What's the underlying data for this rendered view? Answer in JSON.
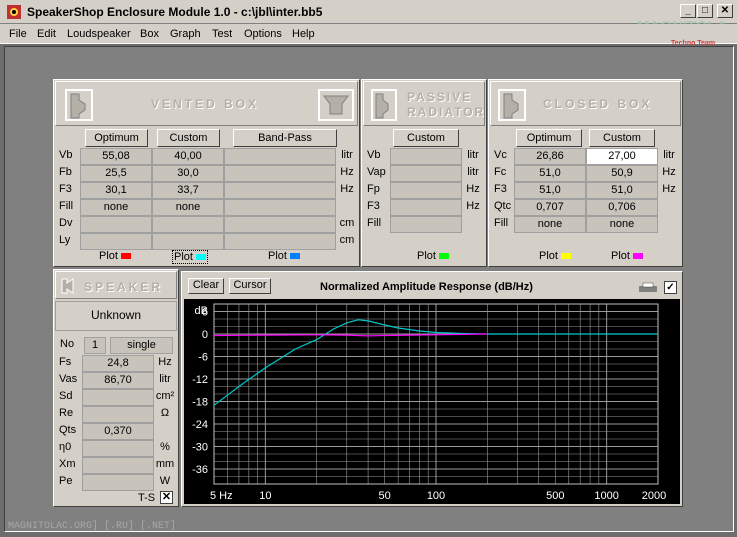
{
  "window": {
    "title": "SpeakerShop Enclosure Module 1.0 - c:\\jbl\\inter.bb5",
    "min": "_",
    "max": "□",
    "close": "✕"
  },
  "watermark_top": "MAGNITOLA",
  "watermark_sub": "Techno Team",
  "menu": [
    "File",
    "Edit",
    "Loudspeaker",
    "Box",
    "Graph",
    "Test",
    "Options",
    "Help"
  ],
  "vented": {
    "title": "VENTED BOX",
    "buttons": [
      "Optimum",
      "Custom",
      "Band-Pass"
    ],
    "labels": [
      "Vb",
      "Fb",
      "F3",
      "Fill",
      "Dv",
      "Ly"
    ],
    "units": [
      "litr",
      "Hz",
      "Hz",
      "",
      "cm",
      "cm"
    ],
    "optimum": [
      "55,08",
      "25,5",
      "30,1",
      "none",
      "",
      ""
    ],
    "custom": [
      "40,00",
      "30,0",
      "33,7",
      "none",
      "",
      ""
    ],
    "plot": "Plot",
    "colors": [
      "#ff0000",
      "#00ffff",
      "#0080ff"
    ]
  },
  "passive": {
    "title1": "PASSIVE",
    "title2": "RADIATOR",
    "button": "Custom",
    "labels": [
      "Vb",
      "Vap",
      "Fp",
      "F3",
      "Fill"
    ],
    "units": [
      "litr",
      "litr",
      "Hz",
      "Hz",
      ""
    ],
    "plot": "Plot",
    "color": "#00ff00"
  },
  "closed": {
    "title": "CLOSED BOX",
    "buttons": [
      "Optimum",
      "Custom"
    ],
    "labels": [
      "Vc",
      "Fc",
      "F3",
      "Qtc",
      "Fill"
    ],
    "units": [
      "litr",
      "Hz",
      "Hz",
      "",
      ""
    ],
    "optimum": [
      "26,86",
      "51,0",
      "51,0",
      "0,707",
      "none"
    ],
    "custom": [
      "27,00",
      "50,9",
      "51,0",
      "0,706",
      "none"
    ],
    "plot": "Plot",
    "colors": [
      "#ffff00",
      "#ff00ff"
    ]
  },
  "speaker": {
    "title": "SPEAKER",
    "name": "Unknown",
    "no_label": "No",
    "no_value": "1",
    "no_mode": "single",
    "rows": [
      {
        "label": "Fs",
        "value": "24,8",
        "unit": "Hz"
      },
      {
        "label": "Vas",
        "value": "86,70",
        "unit": "litr"
      },
      {
        "label": "Sd",
        "value": "",
        "unit": "cm²"
      },
      {
        "label": "Re",
        "value": "",
        "unit": "Ω"
      },
      {
        "label": "Qts",
        "value": "0,370",
        "unit": ""
      },
      {
        "label": "η0",
        "value": "",
        "unit": "%"
      },
      {
        "label": "Xm",
        "value": "",
        "unit": "mm"
      },
      {
        "label": "Pe",
        "value": "",
        "unit": "W"
      }
    ],
    "ts": "T-S",
    "ts_check": "✕"
  },
  "graph": {
    "clear": "Clear",
    "cursor": "Cursor",
    "check": "✓"
  },
  "chart_data": {
    "type": "line",
    "title": "Normalized Amplitude Response (dB/Hz)",
    "ylabel": "dB",
    "x_scale": "log",
    "xlim": [
      5,
      2000
    ],
    "ylim": [
      -40,
      8
    ],
    "x_tick_labels": [
      "5 Hz",
      "10",
      "50",
      "100",
      "500",
      "1000",
      "2000"
    ],
    "x_ticks": [
      5,
      10,
      50,
      100,
      500,
      1000,
      2000
    ],
    "y_ticks": [
      6,
      2,
      -2,
      -6,
      -10,
      -14,
      -18,
      -22,
      -26,
      -30,
      -36
    ],
    "y_tick_labels": [
      "6",
      "0",
      "-6",
      "-12",
      "-18",
      "-24",
      "-30",
      "-36"
    ],
    "grid": true,
    "series": [
      {
        "color": "#00c8c8",
        "x": [
          5,
          7,
          10,
          15,
          20,
          25,
          30,
          35,
          40,
          50,
          60,
          80,
          100,
          150,
          200,
          500,
          2000
        ],
        "y": [
          -19,
          -14,
          -9,
          -4,
          -1.5,
          1.3,
          3,
          3.8,
          3.5,
          2.4,
          1.6,
          0.8,
          0.4,
          0.1,
          0,
          0,
          0
        ]
      },
      {
        "color": "#ff00ff",
        "x": [
          5,
          10,
          20,
          30,
          40,
          50,
          100,
          200
        ],
        "y": [
          -0.4,
          -0.3,
          -0.2,
          -0.3,
          -0.5,
          -0.4,
          -0.2,
          0
        ]
      }
    ]
  },
  "status": "MAGNITOLAC.ORG] [.RU] [.NET]"
}
